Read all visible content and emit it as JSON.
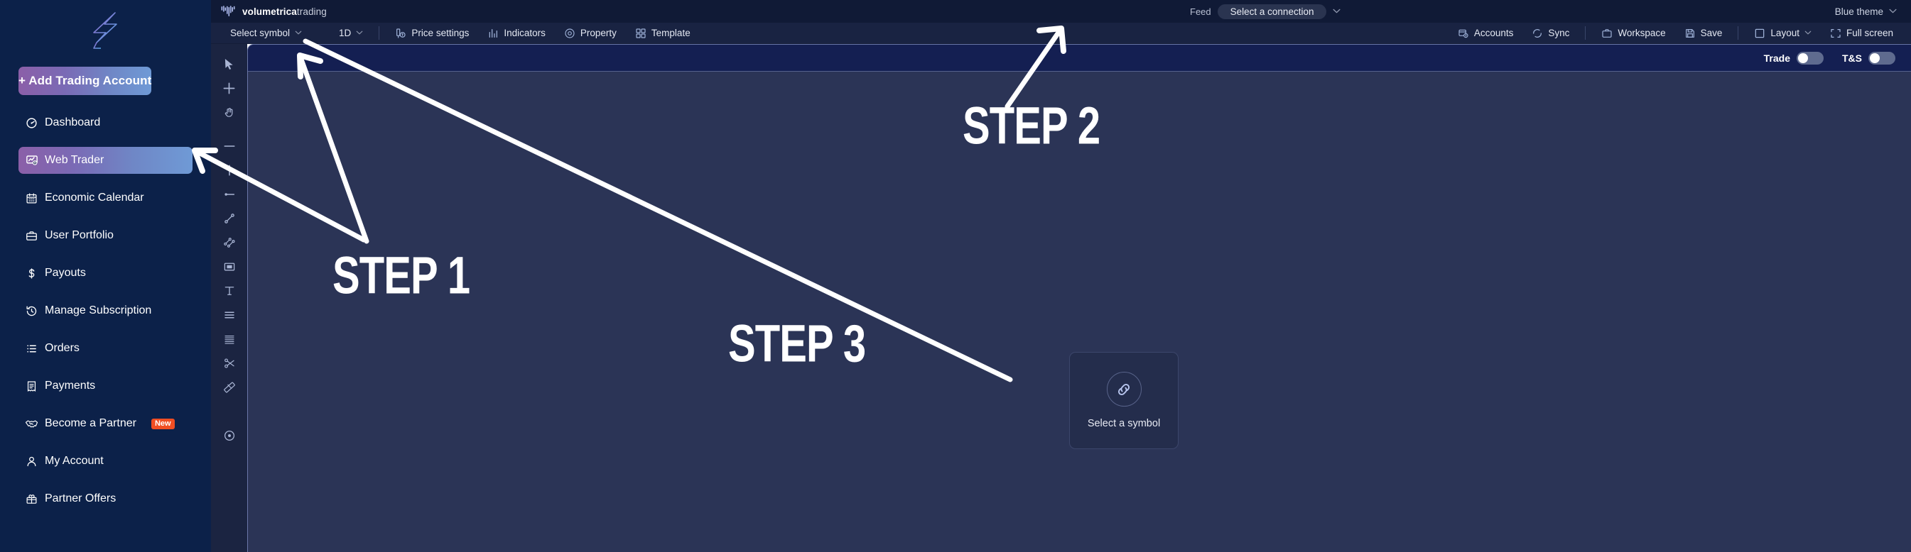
{
  "sidebar": {
    "logo": "volumetrica-logo-mark",
    "cta": {
      "label": "+ Add Trading Account",
      "name": "add-trading-account-button"
    },
    "items": [
      {
        "label": "Dashboard",
        "icon": "dashboard-icon",
        "active": false
      },
      {
        "label": "Web Trader",
        "icon": "web-trader-icon",
        "active": true
      },
      {
        "label": "Economic Calendar",
        "icon": "calendar-icon",
        "active": false
      },
      {
        "label": "User Portfolio",
        "icon": "briefcase-icon",
        "active": false
      },
      {
        "label": "Payouts",
        "icon": "dollar-icon",
        "active": false
      },
      {
        "label": "Manage Subscription",
        "icon": "history-icon",
        "active": false
      },
      {
        "label": "Orders",
        "icon": "list-icon",
        "active": false
      },
      {
        "label": "Payments",
        "icon": "receipt-icon",
        "active": false
      },
      {
        "label": "Become a Partner",
        "icon": "handshake-icon",
        "active": false,
        "badge": "New"
      },
      {
        "label": "My Account",
        "icon": "user-icon",
        "active": false
      },
      {
        "label": "Partner Offers",
        "icon": "gift-icon",
        "active": false
      }
    ]
  },
  "topbar": {
    "brand_bold": "volumetrica",
    "brand_light": "trading",
    "feed_label": "Feed",
    "feed_value": "Select a connection",
    "feed_chevron": "chevron-down-icon",
    "theme_value": "Blue theme",
    "theme_chevron": "chevron-down-icon"
  },
  "toolbar": {
    "left": [
      {
        "label": "Select symbol",
        "icon": "none",
        "chevron": true
      },
      {
        "label": "1D",
        "icon": "none",
        "chevron": true
      },
      {
        "label": "Price settings",
        "icon": "price-settings-icon",
        "chevron": false
      },
      {
        "label": "Indicators",
        "icon": "indicators-icon",
        "chevron": false
      },
      {
        "label": "Property",
        "icon": "property-gear-icon",
        "chevron": false
      },
      {
        "label": "Template",
        "icon": "template-icon",
        "chevron": false
      }
    ],
    "right": [
      {
        "label": "Accounts",
        "icon": "accounts-icon",
        "chevron": false
      },
      {
        "label": "Sync",
        "icon": "sync-icon",
        "chevron": false
      },
      {
        "label": "Workspace",
        "icon": "workspace-icon",
        "chevron": false
      },
      {
        "label": "Save",
        "icon": "save-icon",
        "chevron": false
      },
      {
        "label": "Layout",
        "icon": "layout-icon",
        "chevron": true
      },
      {
        "label": "Full screen",
        "icon": "fullscreen-icon",
        "chevron": false
      }
    ]
  },
  "drawbar": {
    "tools": [
      "cursor-icon",
      "crosshair-icon",
      "hand-icon",
      "horizontal-line-icon",
      "vertical-line-icon",
      "ray-line-icon",
      "trend-line-icon",
      "parallel-channel-icon",
      "rectangle-icon",
      "text-icon",
      "three-lines-icon",
      "multi-lines-icon",
      "scissors-icon",
      "ruler-icon",
      "eye-icon"
    ]
  },
  "chart": {
    "toggles": [
      {
        "label": "Trade",
        "on": false
      },
      {
        "label": "T&S",
        "on": false
      }
    ],
    "empty_state": {
      "icon": "link-icon",
      "caption": "Select a symbol"
    }
  },
  "annotations": {
    "steps": [
      {
        "id": "step1",
        "text": "STEP 1"
      },
      {
        "id": "step2",
        "text": "STEP 2"
      },
      {
        "id": "step3",
        "text": "STEP 3"
      }
    ],
    "arrow_color": "#ffffff"
  },
  "colors": {
    "sidebar_bg": "#0c2149",
    "topbar_bg": "#101a36",
    "toolbar_bg": "#192342",
    "chart_bg": "#2b3456",
    "chart_head_bg": "#141f52",
    "accent_gradient_from": "#8b5fa8",
    "accent_gradient_to": "#6f9ad6",
    "badge_new": "#f04e23"
  }
}
